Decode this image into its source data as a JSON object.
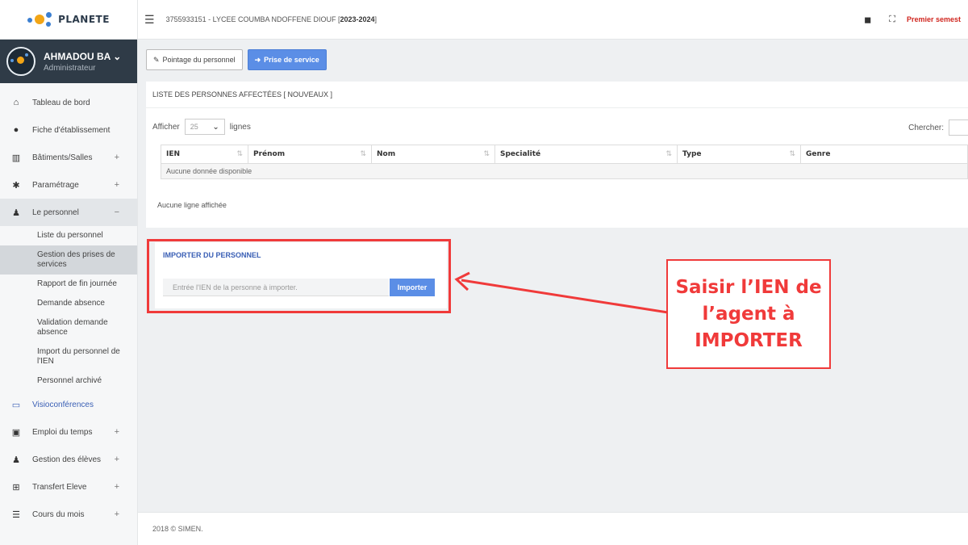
{
  "app": {
    "logo_text": "PLANETE"
  },
  "user": {
    "name": "AHMADOU BA",
    "caret": "⌄",
    "role": "Administrateur"
  },
  "topbar": {
    "school_prefix": "3755933151 - LYCEE COUMBA NDOFFENE DIOUF [",
    "school_year": "2023-2024",
    "school_suffix": "]",
    "semester": "Premier semest"
  },
  "menu": {
    "tableau": "Tableau de bord",
    "fiche": "Fiche d'établissement",
    "batiments": "Bâtiments/Salles",
    "parametrage": "Paramétrage",
    "personnel": "Le personnel",
    "personnel_toggle": "−",
    "plus": "+",
    "sub": {
      "liste": "Liste du personnel",
      "gestion": "Gestion des prises de services",
      "rapport": "Rapport de fin journée",
      "demande": "Demande absence",
      "validation": "Validation demande absence",
      "import": "Import du personnel de l'IEN",
      "archive": "Personnel archivé"
    },
    "visio": "Visioconférences",
    "emploi": "Emploi du temps",
    "eleves": "Gestion des élèves",
    "transfert": "Transfert Eleve",
    "cours": "Cours du mois"
  },
  "toolbar": {
    "pointage": "Pointage du personnel",
    "prise": "Prise de service"
  },
  "list_panel": {
    "title": "LISTE DES PERSONNES AFFECTÉES [ NOUVEAUX ]",
    "show_label": "Afficher",
    "page_size": "25",
    "rows_label": "lignes",
    "search_label": "Chercher:",
    "columns": [
      "IEN",
      "Prénom",
      "Nom",
      "Specialité",
      "Type",
      "Genre"
    ],
    "empty_row": "Aucune donnée disponible",
    "info": "Aucune ligne affichée"
  },
  "import_panel": {
    "title": "IMPORTER DU PERSONNEL",
    "placeholder": "Entrée l'IEN de la personne à importer.",
    "button": "Importer"
  },
  "annotation": {
    "line1": "Saisir l’IEN de",
    "line2": "l’agent à",
    "line3": "IMPORTER"
  },
  "footer": {
    "copyright": "2018 © SIMEN."
  },
  "colors": {
    "accent": "#5b8ee6",
    "annotation_red": "#f03a3a",
    "sidebar_dark": "#2f3b47"
  }
}
